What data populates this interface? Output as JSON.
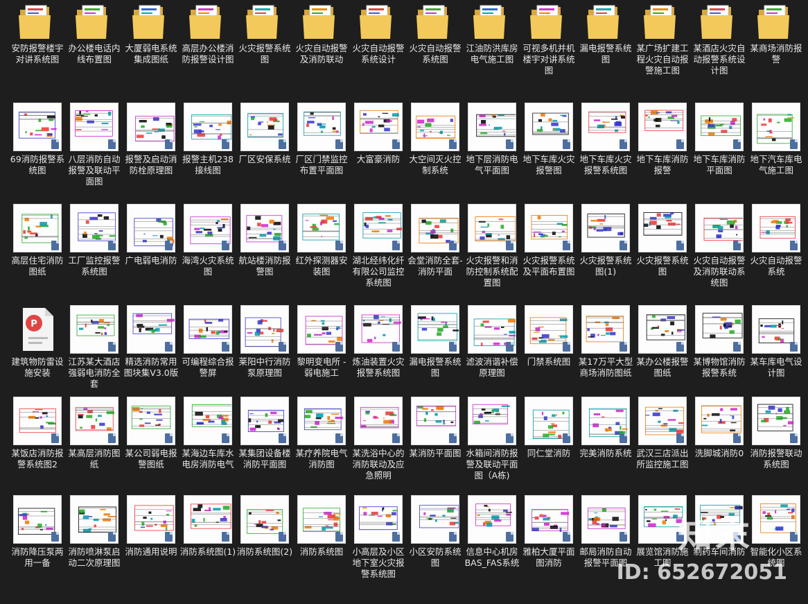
{
  "rows": [
    {
      "kind": "folder",
      "items": [
        "安防报警楼宇对讲系统图",
        "办公楼电话内线布置图",
        "大厦弱电系统集成图纸",
        "高层办公楼消防报警设计图",
        "火灾报警系统图",
        "火灾自动报警及消防联动",
        "火灾自动报警系统设计",
        "火灾自动报警系统图",
        "江油防洪库房电气施工图",
        "可视多机并机楼宇对讲系统图",
        "漏电报警系统图",
        "某广场扩建工程火灾自动报警施工图",
        "某酒店火灾自动报警系统设计图",
        "某商场消防报警"
      ]
    },
    {
      "kind": "file",
      "items": [
        "69消防报警系统图",
        "八层消防自动报警及联动平面图",
        "报警及启动消防栓原理图",
        "报警主机238接线图",
        "厂区安保系统",
        "厂区门禁监控布置平面图",
        "大富豪消防",
        "大空间灭火控制系统",
        "地下层消防电气平面图",
        "地下车库火灾报警图",
        "地下车库火灾报警系统图",
        "地下车库消防报警",
        "地下车库消防平面图",
        "地下汽车库电气施工图"
      ]
    },
    {
      "kind": "file",
      "items": [
        "高层住宅消防图纸",
        "工厂监控报警系统图",
        "广电弱电消防",
        "海湾火灾系统图",
        "航站楼消防报警图",
        "红外探测器安装图",
        "湖北经纬化纤有限公司监控系统图",
        "会堂消防全套-消防平面",
        "火灾报警和消防控制系统配置图",
        "火灾报警系统及平面布置图",
        "火灾报警系统图(1)",
        "火灾报警系统图",
        "火灾自动报警及消防联动系统图",
        "火灾自动报警系统"
      ]
    },
    {
      "kind": "file",
      "items": [
        "建筑物防雷设施安装",
        "江苏某大酒店强弱电消防全套",
        "精选消防常用图块集V3.0版",
        "可编程综合报警屏",
        "莱阳中行消防泵原理图",
        "黎明变电所 - 弱电施工",
        "炼油装置火灾报警系统图",
        "漏电报警系统图",
        "滤波消谐补偿原理图",
        "门禁系统图",
        "某17万平大型商场消防图纸",
        "某办公楼报警图纸",
        "某博物馆消防报警系统",
        "某车库电气设计图"
      ]
    },
    {
      "kind": "file",
      "items": [
        "某饭店消防报警系统图2",
        "某高层消防图纸",
        "某公司弱电报警图纸",
        "某海边车库水电房消防电气",
        "某集团设备楼消防平面图",
        "某疗养院电气消防图",
        "某洗浴中心的消防联动及应急照明",
        "某消防平面图",
        "水箱间消防报警及联动平面图（A栋)",
        "同仁堂消防",
        "完美消防系统",
        "武汉三店派出所监控施工图",
        "洗脚城消防0",
        "消防报警联动系统图"
      ]
    },
    {
      "kind": "file",
      "items": [
        "消防降压泵两用一备",
        "消防喷淋泵启动二次原理图",
        "消防通用说明",
        "消防系统图(1)",
        "消防系统图(2)",
        "消防系统图",
        "小高层及小区地下室火灾报警系统图",
        "小区安防系统图",
        "信息中心机房BAS_FAS系统",
        "雅柏大厦平面图消防",
        "邮局消防自动报警平面图",
        "展览馆消防施工图",
        "制药车间消防",
        "智能化小区系统图"
      ]
    }
  ],
  "pdf_index": [
    3,
    0
  ],
  "watermark": {
    "logo": "知末",
    "id": "ID: 652672051"
  }
}
